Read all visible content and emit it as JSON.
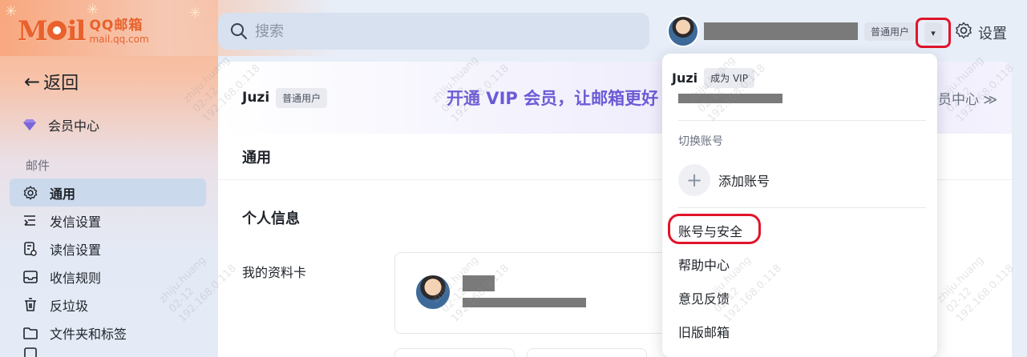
{
  "logo": {
    "mark": "Mail",
    "text1": "QQ邮箱",
    "text2": "mail.qq.com"
  },
  "search": {
    "placeholder": "搜索"
  },
  "account": {
    "badge": "普通用户",
    "caret": "▾"
  },
  "settings": {
    "label": "设置"
  },
  "sidebar": {
    "back_label": "返回",
    "vip_label": "会员中心",
    "section_label": "邮件",
    "items": [
      {
        "label": "通用",
        "icon": "gear-icon",
        "active": true
      },
      {
        "label": "发信设置",
        "icon": "send-settings-icon"
      },
      {
        "label": "读信设置",
        "icon": "read-settings-icon"
      },
      {
        "label": "收信规则",
        "icon": "inbox-rules-icon"
      },
      {
        "label": "反垃圾",
        "icon": "trash-icon"
      },
      {
        "label": "文件夹和标签",
        "icon": "folder-icon"
      }
    ]
  },
  "main": {
    "username": "Juzi",
    "user_badge": "普通用户",
    "promo": "开通 VIP 会员，让邮箱更好",
    "vip_center": "员中心 ≫",
    "section_title": "通用",
    "subsection_title": "个人信息",
    "profile_label": "我的资料卡"
  },
  "dropdown": {
    "name": "Juzi",
    "vip_badge": "成为 VIP",
    "switch_label": "切换账号",
    "add_account": "添加账号",
    "items": [
      "账号与安全",
      "帮助中心",
      "意见反馈",
      "旧版邮箱"
    ]
  },
  "watermark": {
    "line1": "zhiju.huang",
    "line2": "02-12",
    "line3": "192.168.0.118"
  }
}
